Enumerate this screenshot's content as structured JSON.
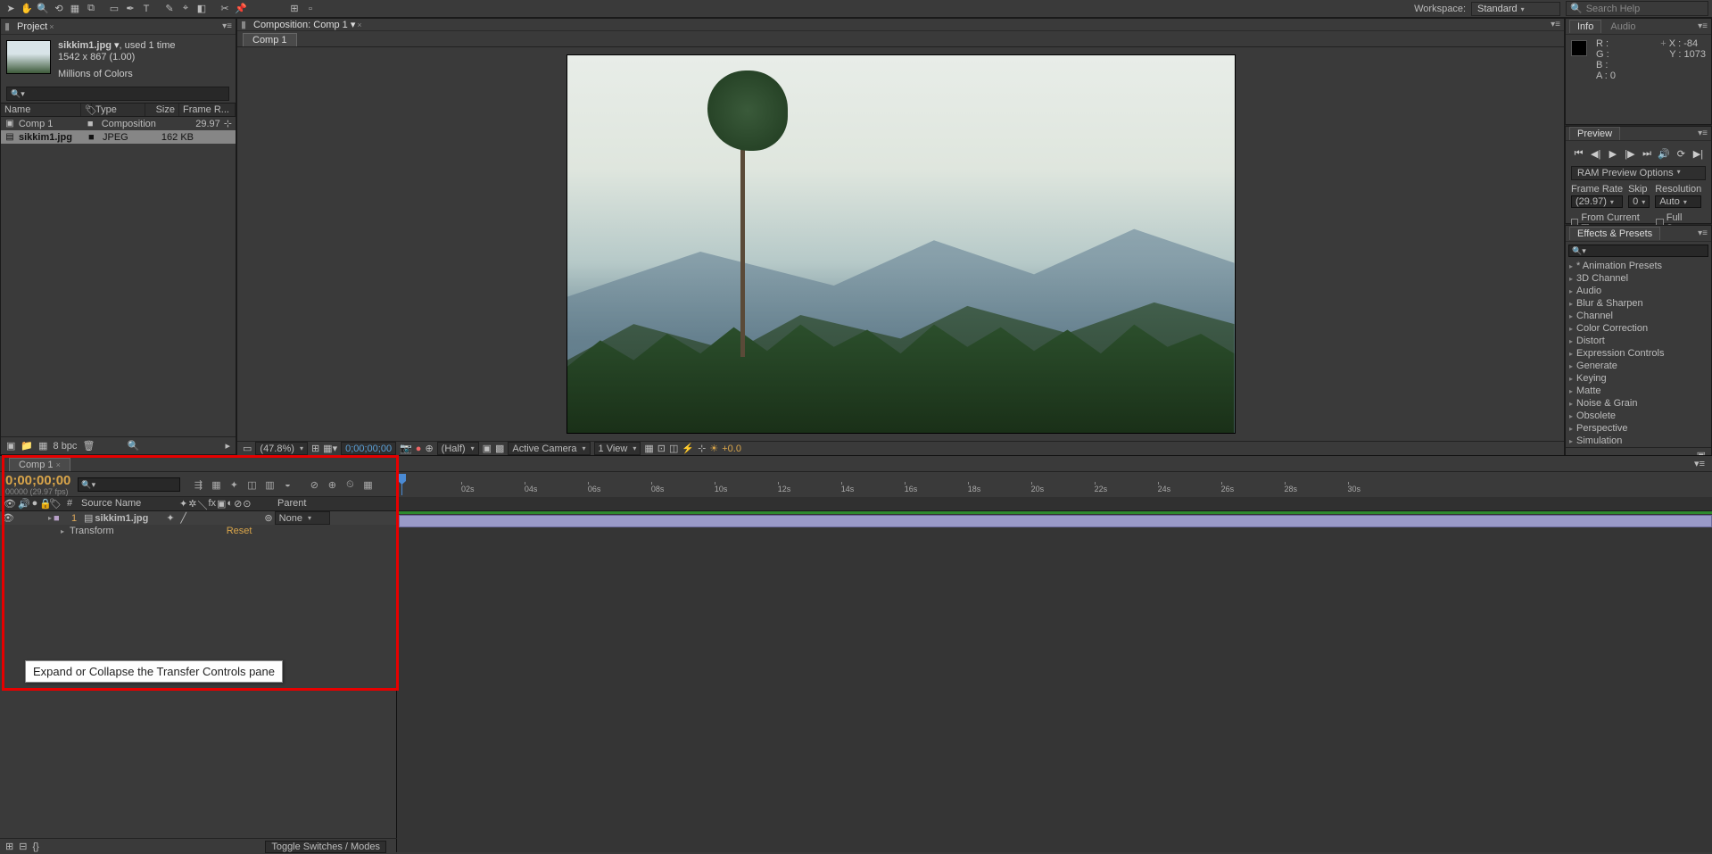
{
  "workspace": {
    "label": "Workspace:",
    "value": "Standard"
  },
  "search_help": {
    "placeholder": "Search Help"
  },
  "project": {
    "title": "Project",
    "file": {
      "name": "sikkim1.jpg",
      "used": ", used 1 time",
      "dims": "1542 x 867 (1.00)",
      "colors": "Millions of Colors"
    },
    "cols": {
      "name": "Name",
      "type": "Type",
      "size": "Size",
      "fr": "Frame R..."
    },
    "rows": [
      {
        "name": "Comp 1",
        "type": "Composition",
        "size": "",
        "fr": "29.97"
      },
      {
        "name": "sikkim1.jpg",
        "type": "JPEG",
        "size": "162 KB",
        "fr": ""
      }
    ],
    "bpc": "8 bpc"
  },
  "composition": {
    "header": "Composition: Comp 1",
    "tab": "Comp 1",
    "footer": {
      "zoom": "(47.8%)",
      "time": "0;00;00;00",
      "res": "(Half)",
      "cam": "Active Camera",
      "view": "1 View",
      "exp": "+0.0"
    }
  },
  "info": {
    "title": "Info",
    "audio": "Audio",
    "r": "R :",
    "g": "G :",
    "b": "B :",
    "a": "A :  0",
    "x": "X : -84",
    "y": "Y : 1073"
  },
  "preview": {
    "title": "Preview",
    "ram": "RAM Preview Options",
    "fr_lbl": "Frame Rate",
    "fr_val": "(29.97)",
    "skip_lbl": "Skip",
    "skip_val": "0",
    "res_lbl": "Resolution",
    "res_val": "Auto",
    "from": "From Current Time",
    "full": "Full Screen"
  },
  "effects": {
    "title": "Effects & Presets",
    "items": [
      "* Animation Presets",
      "3D Channel",
      "Audio",
      "Blur & Sharpen",
      "Channel",
      "Color Correction",
      "Distort",
      "Expression Controls",
      "Generate",
      "Keying",
      "Matte",
      "Noise & Grain",
      "Obsolete",
      "Perspective",
      "Simulation"
    ]
  },
  "timeline": {
    "tab": "Comp 1",
    "timecode": "0;00;00;00",
    "sub": "00000 (29.97 fps)",
    "cols": {
      "src": "Source Name",
      "parent": "Parent"
    },
    "layer": {
      "num": "1",
      "name": "sikkim1.jpg",
      "parent": "None",
      "transform": "Transform",
      "reset": "Reset"
    },
    "ruler": [
      "02s",
      "04s",
      "06s",
      "08s",
      "10s",
      "12s",
      "14s",
      "16s",
      "18s",
      "20s",
      "22s",
      "24s",
      "26s",
      "28s",
      "30s"
    ],
    "toggle": "Toggle Switches / Modes"
  },
  "tooltip": "Expand or Collapse the Transfer Controls pane"
}
